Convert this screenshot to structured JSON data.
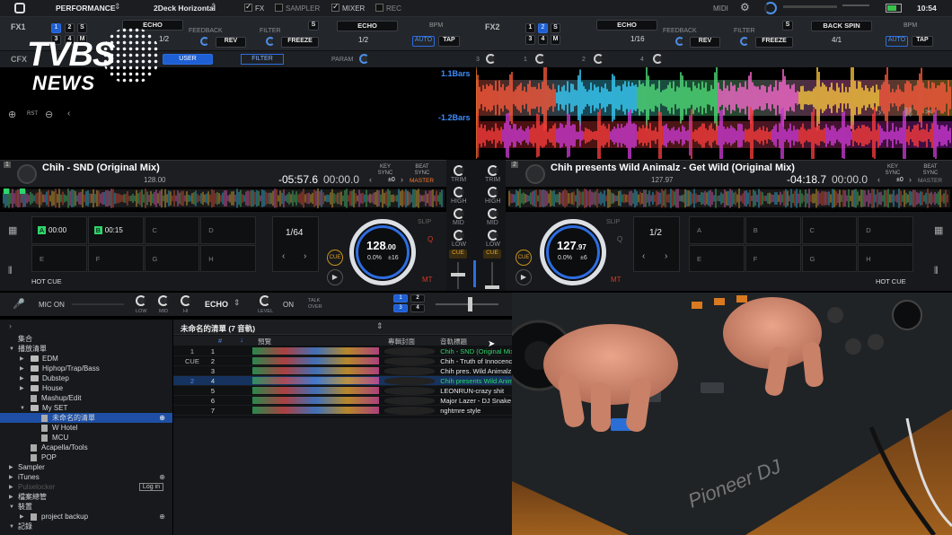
{
  "topbar": {
    "mode": "PERFORMANCE",
    "layout": "2Deck Horizontal",
    "fx": "FX",
    "sampler": "SAMPLER",
    "mixer": "MIXER",
    "rec": "REC",
    "midi": "MIDI",
    "time": "10:54"
  },
  "fx1": {
    "label": "FX1",
    "slots": [
      "1",
      "2",
      "S",
      "3",
      "4",
      "M"
    ],
    "effect": "ECHO",
    "fraction": "1/2",
    "feedback": "FEEDBACK",
    "rev": "REV",
    "filter": "FILTER",
    "freeze": "FREEZE",
    "s": "S",
    "effect2": "ECHO",
    "fraction2": "1/2",
    "bpm": "BPM",
    "auto": "AUTO",
    "tap": "TAP"
  },
  "fx2": {
    "label": "FX2",
    "slots": [
      "1",
      "2",
      "S",
      "3",
      "4",
      "M"
    ],
    "effect": "ECHO",
    "fraction": "1/16",
    "feedback": "FEEDBACK",
    "rev": "REV",
    "filter": "FILTER",
    "freeze": "FREEZE",
    "s": "S",
    "effect2": "BACK SPIN",
    "fraction2": "4/1",
    "bpm": "BPM",
    "auto": "AUTO",
    "tap": "TAP"
  },
  "cfx": {
    "label": "CFX",
    "user": "USER",
    "filter": "FILTER",
    "param": "PARAM",
    "channels": [
      "3",
      "1",
      "2",
      "4"
    ]
  },
  "wave": {
    "bars_top": "1.1Bars",
    "bars_bottom": "-1.2Bars",
    "rst": "RST"
  },
  "deck1": {
    "number": "1",
    "title": "Chih - SND (Original Mix)",
    "bpm_sub": "128.00",
    "remain": "-05:57.6",
    "elapsed": "00:00.0",
    "key_sync": "KEY SYNC",
    "beat_sync": "BEAT SYNC",
    "master": "MASTER",
    "key_val": "±0",
    "hotcues": [
      {
        "letter": "A",
        "time": "00:00"
      },
      {
        "letter": "B",
        "time": "00:15"
      },
      {
        "letter": "C",
        "time": ""
      },
      {
        "letter": "D",
        "time": ""
      },
      {
        "letter": "E",
        "time": ""
      },
      {
        "letter": "F",
        "time": ""
      },
      {
        "letter": "G",
        "time": ""
      },
      {
        "letter": "H",
        "time": ""
      }
    ],
    "loop": "1/64",
    "bpm_big": "128",
    "bpm_dec": ".00",
    "pitch": "0.0%",
    "range": "±16",
    "slip": "SLIP",
    "q": "Q",
    "mt": "MT",
    "cue": "CUE",
    "hot_cue_label": "HOT CUE"
  },
  "deck2": {
    "number": "2",
    "title": "Chih presents Wild Animalz - Get Wild (Original Mix)",
    "bpm_sub": "127.97",
    "remain": "-04:18.7",
    "elapsed": "00:00.0",
    "key_sync": "KEY SYNC",
    "beat_sync": "BEAT SYNC",
    "master": "MASTER",
    "key_val": "±0",
    "hotcues": [
      {
        "letter": "A",
        "time": ""
      },
      {
        "letter": "B",
        "time": ""
      },
      {
        "letter": "C",
        "time": ""
      },
      {
        "letter": "D",
        "time": ""
      },
      {
        "letter": "E",
        "time": ""
      },
      {
        "letter": "F",
        "time": ""
      },
      {
        "letter": "G",
        "time": ""
      },
      {
        "letter": "H",
        "time": ""
      }
    ],
    "loop": "1/2",
    "bpm_big": "127",
    "bpm_dec": ".97",
    "pitch": "0.0%",
    "range": "±6",
    "slip": "SLIP",
    "q": "Q",
    "mt": "MT",
    "cue": "CUE",
    "hot_cue_label": "HOT CUE"
  },
  "mixer": {
    "trim": "TRIM",
    "high": "HIGH",
    "mid": "MID",
    "low": "LOW",
    "cue": "CUE"
  },
  "mic": {
    "label": "MIC ON",
    "low": "LOW",
    "mid": "MID",
    "hi": "HI",
    "echo": "ECHO",
    "level": "LEVEL",
    "on": "ON",
    "talkover": "TALK OVER",
    "decks": [
      "1",
      "2",
      "3",
      "4"
    ]
  },
  "tree": {
    "items": [
      {
        "label": "集合",
        "indent": 0,
        "arrow": "",
        "icon": ""
      },
      {
        "label": "播放清單",
        "indent": 0,
        "arrow": "▼",
        "icon": ""
      },
      {
        "label": "EDM",
        "indent": 1,
        "arrow": "▶",
        "icon": "folder"
      },
      {
        "label": "Hiphop/Trap/Bass",
        "indent": 1,
        "arrow": "▶",
        "icon": "folder"
      },
      {
        "label": "Dubstep",
        "indent": 1,
        "arrow": "▶",
        "icon": "folder"
      },
      {
        "label": "House",
        "indent": 1,
        "arrow": "▶",
        "icon": "folder"
      },
      {
        "label": "Mashup/Edit",
        "indent": 1,
        "arrow": "",
        "icon": "doc"
      },
      {
        "label": "My SET",
        "indent": 1,
        "arrow": "▼",
        "icon": "folder"
      },
      {
        "label": "未命名的清單",
        "indent": 2,
        "arrow": "",
        "icon": "doc",
        "selected": true
      },
      {
        "label": "W Hotel",
        "indent": 2,
        "arrow": "",
        "icon": "doc"
      },
      {
        "label": "MCU",
        "indent": 2,
        "arrow": "",
        "icon": "doc"
      },
      {
        "label": "Acapella/Tools",
        "indent": 1,
        "arrow": "",
        "icon": "doc"
      },
      {
        "label": "POP",
        "indent": 1,
        "arrow": "",
        "icon": "doc"
      },
      {
        "label": "Sampler",
        "indent": 0,
        "arrow": "▶",
        "icon": ""
      },
      {
        "label": "iTunes",
        "indent": 0,
        "arrow": "▶",
        "icon": ""
      },
      {
        "label": "Pulselocker",
        "indent": 0,
        "arrow": "▶",
        "icon": "",
        "dim": true
      },
      {
        "label": "檔案總管",
        "indent": 0,
        "arrow": "▶",
        "icon": ""
      },
      {
        "label": "裝置",
        "indent": 0,
        "arrow": "▼",
        "icon": ""
      },
      {
        "label": "project backup",
        "indent": 1,
        "arrow": "▶",
        "icon": "doc"
      },
      {
        "label": "記錄",
        "indent": 0,
        "arrow": "▼",
        "icon": ""
      }
    ],
    "login": "Log in"
  },
  "playlist": {
    "title": "未命名的清單 (7 音軌)",
    "columns": {
      "num": "#",
      "preview": "預覽",
      "art": "專輯封面",
      "track": "音軌標題"
    },
    "rows": [
      {
        "deck": "1",
        "num": "1",
        "title": "Chih - SND (Original Mix)",
        "color": "#2fd56a"
      },
      {
        "deck": "CUE",
        "num": "2",
        "title": "Chih - Truth of Innocence",
        "color": "#e8e8e8"
      },
      {
        "deck": "",
        "num": "3",
        "title": "Chih pres. Wild Animalz",
        "color": "#e8e8e8"
      },
      {
        "deck": "2",
        "num": "4",
        "title": "Chih presents Wild Animalz",
        "color": "#2fd56a"
      },
      {
        "deck": "",
        "num": "5",
        "title": "LEONRUN-crazy shit",
        "color": "#e8e8e8"
      },
      {
        "deck": "",
        "num": "6",
        "title": "Major Lazer - DJ Snake",
        "color": "#e8e8e8"
      },
      {
        "deck": "",
        "num": "7",
        "title": "nghtmre style",
        "color": "#e8e8e8"
      }
    ]
  },
  "brand": {
    "logo_top": "TVBS",
    "logo_bottom": "NEWS",
    "overlay_text": "Pioneer DJ"
  }
}
